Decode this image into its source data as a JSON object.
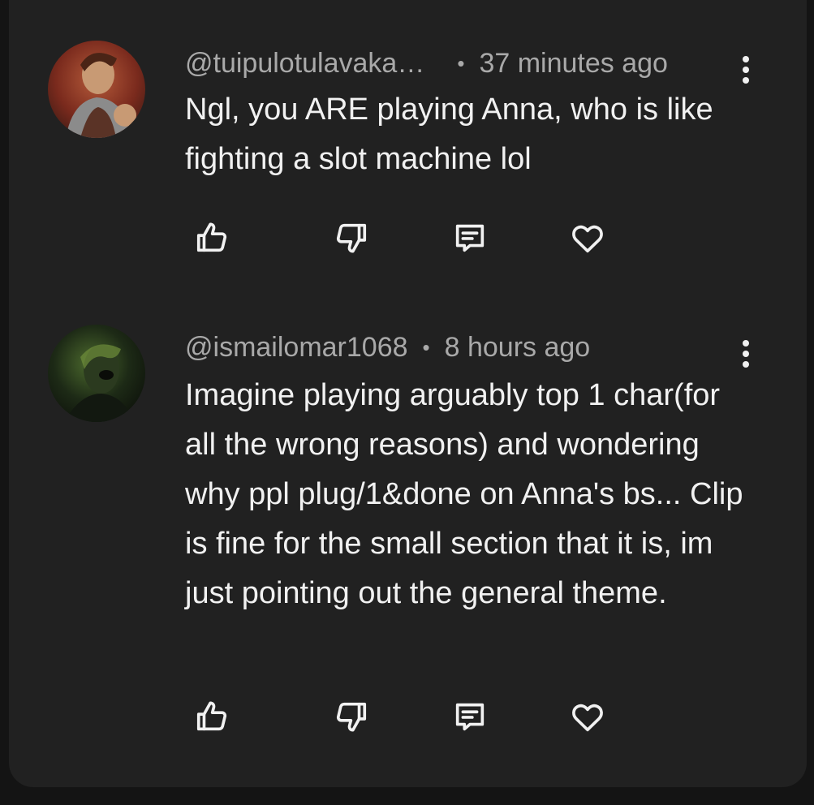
{
  "comments": [
    {
      "author": "@tuipulotulavaka…",
      "separator": "•",
      "time": "37 minutes ago",
      "text": "Ngl, you ARE playing Anna, who is like fighting a slot machine lol",
      "avatar_colors": [
        "#7a2a1d",
        "#c89a74",
        "#3a1a14"
      ]
    },
    {
      "author": "@ismailomar1068",
      "separator": "•",
      "time": "8 hours ago",
      "text": "Imagine playing arguably top 1 char(for all the wrong reasons) and wondering why ppl plug/1&done on Anna's bs... Clip is fine for the small section that it is, im just pointing out the general theme.",
      "avatar_colors": [
        "#1d2a16",
        "#4d6b2e",
        "#0c100a"
      ]
    }
  ],
  "theme": {
    "panel_bg": "#212121",
    "page_bg": "#141414",
    "text": "#f1f1f1",
    "meta_text": "#a9a9a9"
  },
  "icons": {
    "like": "thumbs-up-icon",
    "dislike": "thumbs-down-icon",
    "reply": "reply-comment-icon",
    "heart": "heart-icon",
    "more": "more-vertical-icon"
  }
}
